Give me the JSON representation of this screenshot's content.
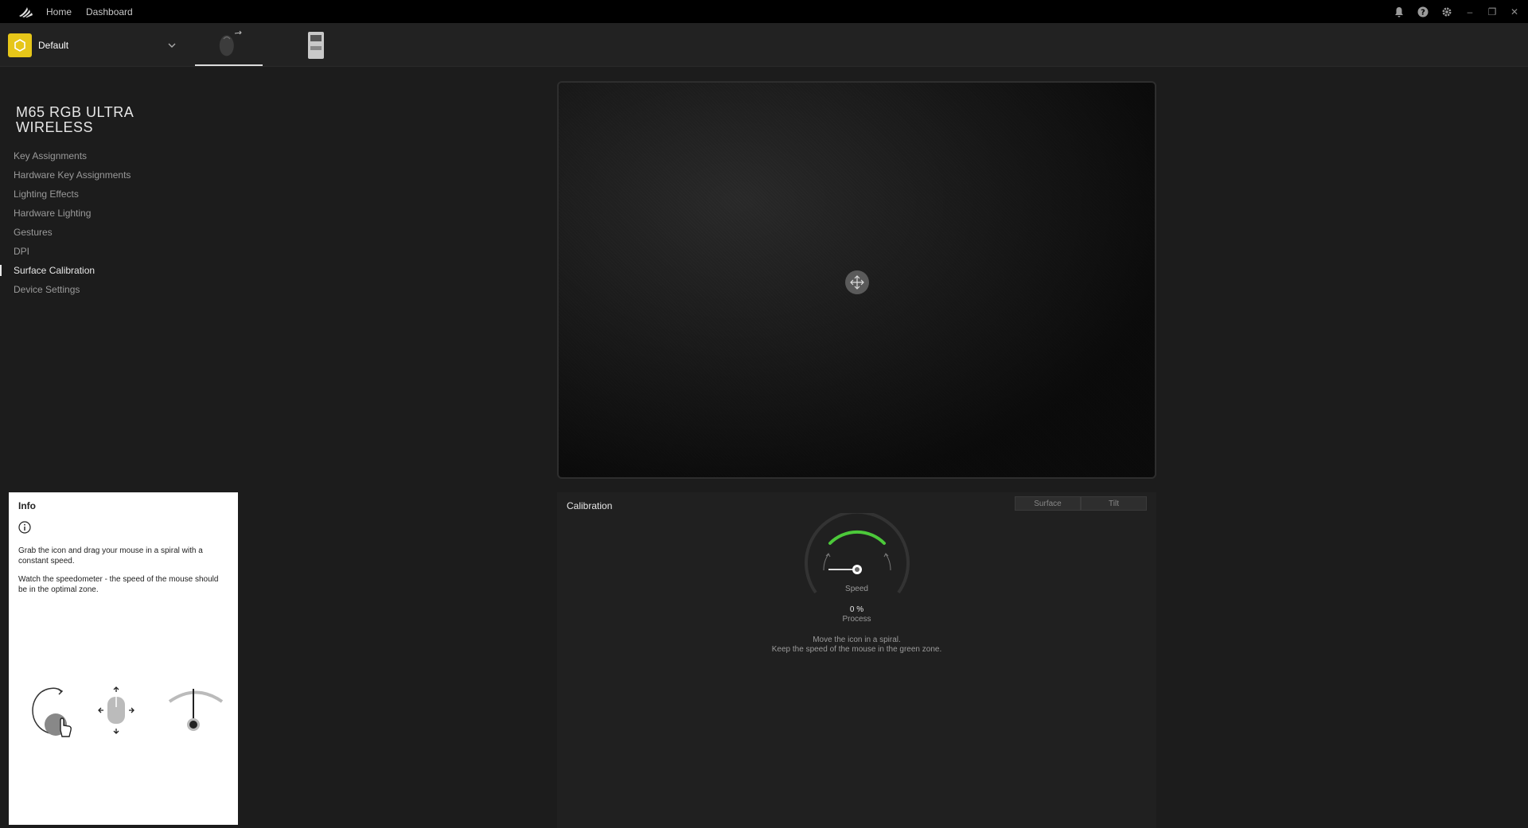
{
  "nav": {
    "home": "Home",
    "dashboard": "Dashboard"
  },
  "profile": {
    "name": "Default"
  },
  "device": {
    "title": "M65 RGB ULTRA WIRELESS",
    "menu": [
      {
        "label": "Key Assignments"
      },
      {
        "label": "Hardware Key Assignments"
      },
      {
        "label": "Lighting Effects"
      },
      {
        "label": "Hardware Lighting"
      },
      {
        "label": "Gestures"
      },
      {
        "label": "DPI"
      },
      {
        "label": "Surface Calibration"
      },
      {
        "label": "Device Settings"
      }
    ],
    "active_menu": "Surface Calibration"
  },
  "info": {
    "title": "Info",
    "text1": "Grab the icon and drag your mouse in a spiral with a constant speed.",
    "text2": "Watch the speedometer - the speed of the mouse should be in the optimal zone."
  },
  "calibration": {
    "title": "Calibration",
    "tabs": [
      "Surface",
      "Tilt"
    ],
    "speed_label": "Speed",
    "process_value": "0 %",
    "process_label": "Process",
    "instruction1": "Move the icon in a spiral.",
    "instruction2": "Keep the speed of the mouse in the green zone."
  },
  "colors": {
    "accent": "#e6c619",
    "green": "#4cc93a"
  }
}
